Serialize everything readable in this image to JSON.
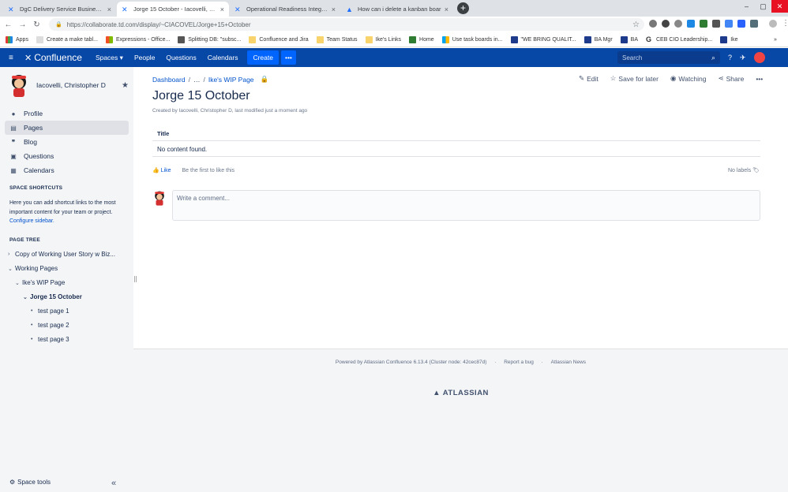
{
  "browser": {
    "tabs": [
      {
        "title": "DgC Delivery Service Business Re",
        "active": false
      },
      {
        "title": "Jorge 15 October - Iacovelli, Chri",
        "active": true
      },
      {
        "title": "Operational Readiness Integratio",
        "active": false
      },
      {
        "title": "How can i delete a kanban boar",
        "active": false
      }
    ],
    "url": "https://collaborate.td.com/display/~CIACOVEL/Jorge+15+October",
    "bookmarks": [
      "Apps",
      "Create a make tabl...",
      "Expressions - Office...",
      "Splitting DB: \"subsc...",
      "Confluence and Jira",
      "Team Status",
      "Ike's Links",
      "Home",
      "Use task boards in...",
      "\"WE BRING QUALIT...",
      "BA Mgr",
      "BA",
      "CEB CIO Leadership...",
      "Ike"
    ],
    "more_bookmarks": "»"
  },
  "nav": {
    "logo": "Confluence",
    "spaces": "Spaces",
    "people": "People",
    "questions": "Questions",
    "calendars": "Calendars",
    "create": "Create",
    "more": "•••",
    "search_placeholder": "Search"
  },
  "sidebar": {
    "space_name": "Iacovelli, Christopher D",
    "items": [
      {
        "label": "Profile",
        "icon": "person-icon"
      },
      {
        "label": "Pages",
        "icon": "pages-icon"
      },
      {
        "label": "Blog",
        "icon": "quote-icon"
      },
      {
        "label": "Questions",
        "icon": "question-icon"
      },
      {
        "label": "Calendars",
        "icon": "calendar-icon"
      }
    ],
    "shortcuts_heading": "SPACE SHORTCUTS",
    "shortcuts_text": "Here you can add shortcut links to the most important content for your team or project.",
    "configure_link": "Configure sidebar.",
    "tree_heading": "PAGE TREE",
    "tree": [
      {
        "label": "Copy of Working User Story w Biz..."
      },
      {
        "label": "Working Pages"
      },
      {
        "label": "Ike's WIP Page"
      },
      {
        "label": "Jorge 15 October"
      },
      {
        "label": "test page 1"
      },
      {
        "label": "test page 2"
      },
      {
        "label": "test page 3"
      }
    ],
    "space_tools": "Space tools"
  },
  "page": {
    "breadcrumb": [
      "Dashboard",
      "/",
      "…",
      "/",
      "Ike's WIP Page"
    ],
    "tools": {
      "edit": "Edit",
      "save": "Save for later",
      "watching": "Watching",
      "share": "Share",
      "more": "•••"
    },
    "title": "Jorge 15 October",
    "meta": "Created by Iacovelli, Christopher D, last modified just a moment ago",
    "table_header": "Title",
    "table_empty": "No content found.",
    "like": "Like",
    "like_prompt": "Be the first to like this",
    "labels": "No labels",
    "comment_placeholder": "Write a comment..."
  },
  "footer": {
    "powered": "Powered by Atlassian Confluence 6.13.4 (Cluster node: 42cec87d)",
    "sep": "·",
    "bug": "Report a bug",
    "news": "Atlassian News",
    "brand": "ATLASSIAN"
  },
  "colors": {
    "nav": "#0747a6",
    "accent": "#0052cc",
    "sidebar": "#f4f5f7"
  }
}
